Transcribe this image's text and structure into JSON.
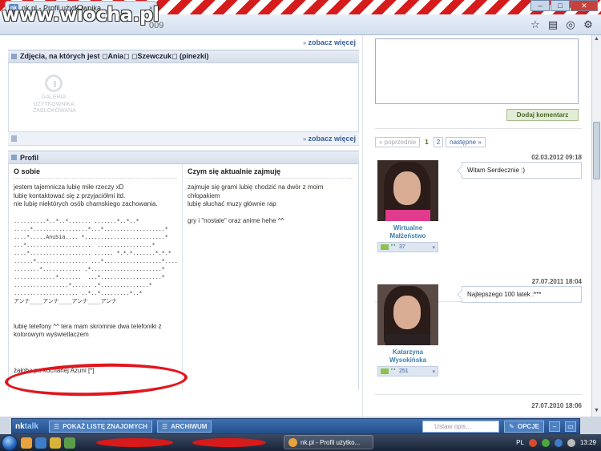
{
  "browser": {
    "tab_title": "nk.pl - Profil użytkownika",
    "favicon_text": "nk",
    "tab_close": "×",
    "url_fragment": "009",
    "watermark": "www.wiocha.pl",
    "window_buttons": [
      "–",
      "□",
      "✕"
    ],
    "toolbar_icons": [
      "star-icon",
      "page-icon",
      "gear-icon",
      "wrench-icon"
    ],
    "toolbar_glyphs": [
      "☆",
      "▤",
      "◎",
      "⚙"
    ]
  },
  "photos_section": {
    "see_more_top": "zobacz więcej",
    "header": "Zdjęcia, na których jest ◻Ania◻ ◻Szewczuk◻ (pinezki)",
    "locked_text": "GALERIA UŻYTKOWNIKA ZABLOKOWANA",
    "see_more_bottom": "zobacz więcej"
  },
  "profile_section": {
    "header": "Profil",
    "about_title": "O sobie",
    "about_text": "jestem tajemnicza lubię miłe rzeczy xD\nlubię kontaktować się z przyjaciółmi itd.\nnie lubię niektórych osób chamskiego zachowania.",
    "ascii_art": "..........*..*..*....... .......*..*..*\n.....*.................*...*...................*\n....*.....AnuSia.... *.........................*\n...*....................  .................*\n....*................... ...... *.*.*.......*.*.*\n......*................ ...*..................*....*\n........*............ .*......................*\n.............*.......  ...*...................*\n.................*...... .*...............*\n.................... ..*..*.........*..*\nアンナ____アンナ____アンナ____アンナ",
    "phones_text": "lubię telefony ^^ tera mam skromnie dwa telefoniki z kolorowym wyświetlaczem",
    "mourning_text": "żałoba po kochanej Azuni [*]",
    "doing_title": "Czym się aktualnie zajmuję",
    "doing_text": "zajmuje się grami lubię chodzić na dwór z moim chłopakiem\nlubię słuchać muzy głównie rap\n\ngry i \"nostale\" oraz anime hehe ^^"
  },
  "comments": {
    "add_button": "Dodaj komentarz",
    "pager": {
      "prev": "« poprzednie",
      "current": "1",
      "page2": "2",
      "next": "następne »"
    },
    "entries": [
      {
        "date": "02.03.2012 09:18",
        "name": "Wirtualne Małżeństwo",
        "count": "37",
        "message": "Witam Serdecznie :)"
      },
      {
        "date": "27.07.2011 18:04",
        "name": "Katarzyna Wysokińska",
        "count": "251",
        "message": "Najlepszego 100 latek :***"
      },
      {
        "date": "27.07.2010 18:06"
      }
    ]
  },
  "nktalk": {
    "logo_a": "nk",
    "logo_b": "talk",
    "show_friends": "POKAŻ LISTĘ ZNAJOMYCH",
    "archive": "ARCHIWUM",
    "status_placeholder": "Ustaw opis...",
    "options": "OPCJE"
  },
  "taskbar": {
    "active_window": "nk.pl - Profil użytko...",
    "language": "PL",
    "clock": "13:29"
  },
  "colors": {
    "accent": "#3a5f9a",
    "highlight_circle": "#e0161d",
    "add_button_text": "#4a6a2a"
  }
}
